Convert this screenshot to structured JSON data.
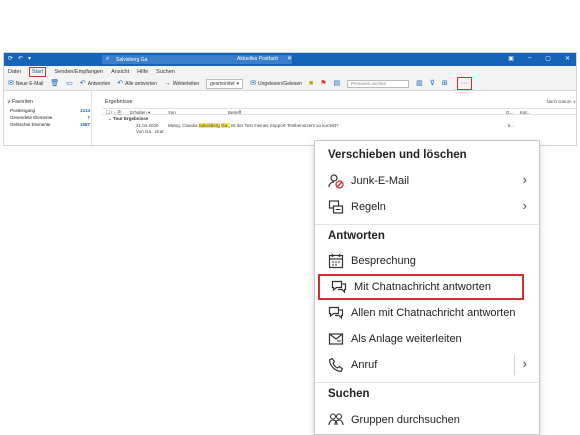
{
  "window": {
    "search_text": "Salvisberg Ga",
    "title": "Aktuelles Postfach",
    "close_glyph": "✕"
  },
  "menubar": [
    "Datei",
    "Start",
    "Senden/Empfangen",
    "Ansicht",
    "Hilfe",
    "Suchen"
  ],
  "ribbon": {
    "new_mail": "Neue E-Mail",
    "reply": "Antworten",
    "reply_all": "Alle antworten",
    "forward": "Weiterleiten",
    "move": "gesmonitet",
    "read_unread": "Ungelesen/Gelesen",
    "search_people_placeholder": "Personen suchen",
    "more": "···"
  },
  "sidebar": {
    "header": "Favoriten",
    "items": [
      {
        "label": "Posteingang",
        "count": "2114"
      },
      {
        "label": "Gesendete Elemente",
        "count": "7"
      },
      {
        "label": "Gelöschte Elemente",
        "count": "1587"
      }
    ]
  },
  "list": {
    "title": "Ergebnisse",
    "sort": "Nach Datum ∨",
    "columns": {
      "arrange": "Erhalten ▾",
      "from": "Von",
      "subject": "Betreff",
      "size": "G...",
      "category": "Kat..."
    },
    "group": "Tour Ergebnisse",
    "message": {
      "date": "21.04.2020",
      "from": "Von Ga.. Grat",
      "subject_pre": "Mwsg. Claudia",
      "subject_hl": "Salvisberg",
      "subject_hl2": "Ga..",
      "subject_post": "Ist der Test meines Support-Testbenutzers so korrekt?",
      "size": "5..."
    }
  },
  "menu": {
    "sections": {
      "move_delete": "Verschieben und löschen",
      "reply": "Antworten",
      "search": "Suchen"
    },
    "items": {
      "junk": "Junk-E-Mail",
      "rules": "Regeln",
      "meeting": "Besprechung",
      "reply_chat": "Mit Chatnachricht antworten",
      "reply_all_chat": "Allen mit Chatnachricht antworten",
      "forward_attachment": "Als Anlage weiterleiten",
      "call": "Anruf",
      "search_groups": "Gruppen durchsuchen"
    }
  },
  "colors": {
    "accent": "#1564b8",
    "highlight_box": "#d32f2f",
    "search_highlight": "#f7e84e"
  }
}
